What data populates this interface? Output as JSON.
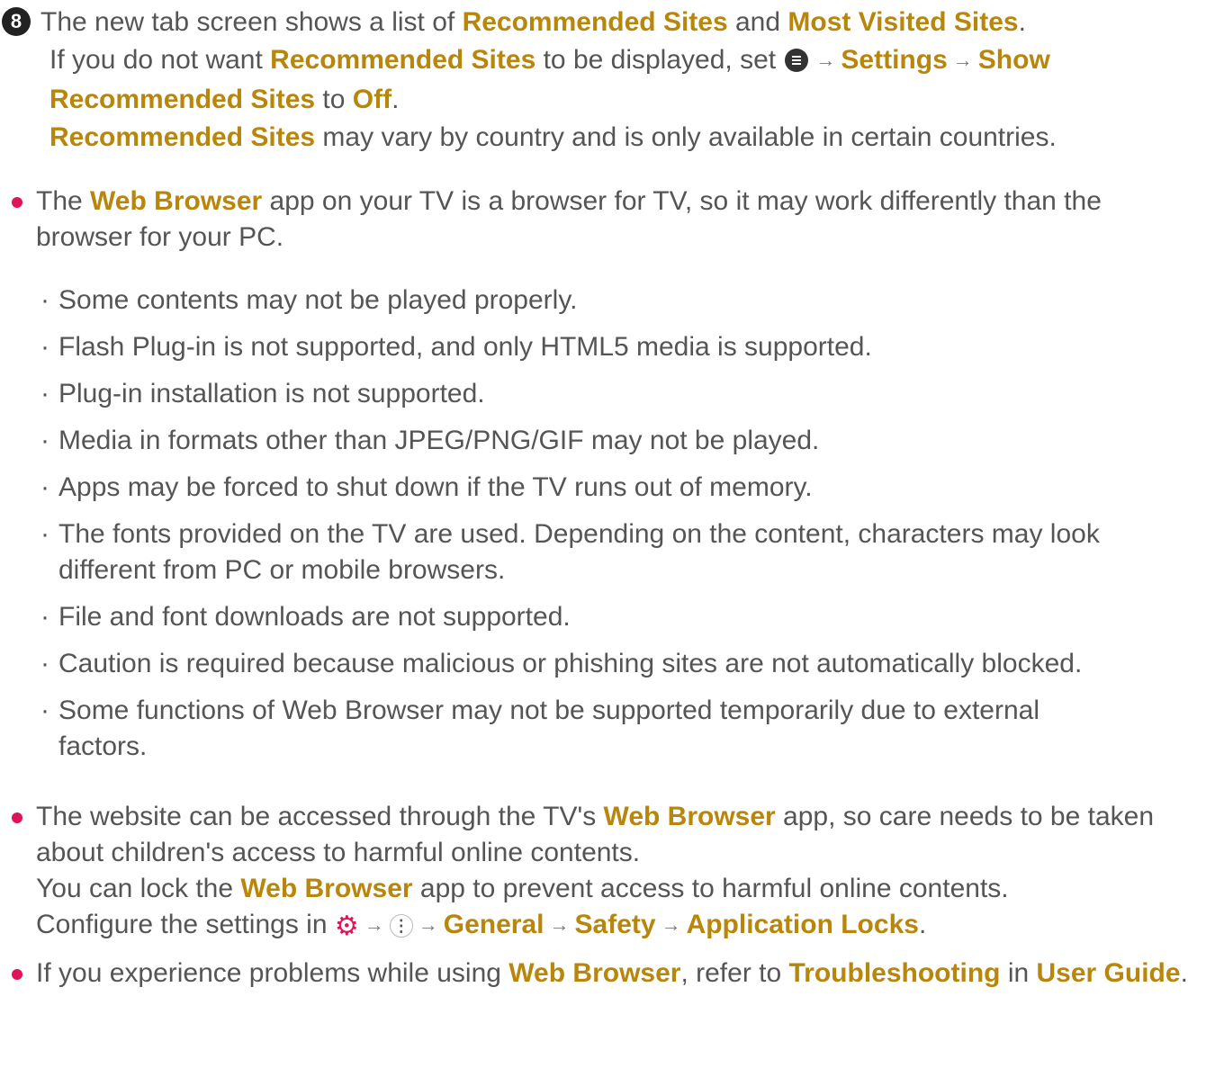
{
  "step8": {
    "number": "8",
    "line1": [
      "The new tab screen shows a list of ",
      "Recommended Sites",
      " and ",
      "Most Visited Sites",
      "."
    ],
    "line2": [
      "If you do not want ",
      "Recommended Sites",
      " to be displayed, set ",
      "Settings",
      "Show Recommended Sites",
      " to ",
      "Off",
      "."
    ],
    "line3": [
      "Recommended Sites",
      " may vary by country and is only available in certain countries."
    ]
  },
  "bullet1": {
    "text": [
      "The ",
      "Web Browser",
      " app on your TV is a browser for TV, so it may work differently than the browser for your PC."
    ],
    "items": [
      "Some contents may not be played properly.",
      "Flash Plug-in is not supported, and only HTML5 media is supported.",
      "Plug-in installation is not supported.",
      "Media in formats other than JPEG/PNG/GIF may not be played.",
      "Apps may be forced to shut down if the TV runs out of memory.",
      "The fonts provided on the TV are used. Depending on the content, characters may look different from PC or mobile browsers.",
      "File and font downloads are not supported.",
      "Caution is required because malicious or phishing sites are not automatically blocked.",
      "Some functions of Web Browser may not be supported temporarily due to external factors."
    ]
  },
  "bullet2": {
    "line1": [
      "The website can be accessed through the TV's ",
      "Web Browser",
      " app, so care needs to be taken about children's access to harmful online contents."
    ],
    "line2": [
      "You can lock the ",
      "Web Browser",
      " app to prevent access to harmful online contents."
    ],
    "line3": [
      "Configure the settings in ",
      "General",
      "Safety",
      "Application Locks",
      "."
    ]
  },
  "bullet3": {
    "line1": [
      "If you experience problems while using ",
      "Web Browser",
      ", refer to ",
      "Troubleshooting",
      " in ",
      "User Guide",
      "."
    ]
  },
  "icons": {
    "menu": "menu-icon",
    "gear": "gear-icon",
    "more": "more-dots-icon",
    "arrow": "→",
    "accent": "#b8860b",
    "bullet_color": "#e0125a"
  }
}
